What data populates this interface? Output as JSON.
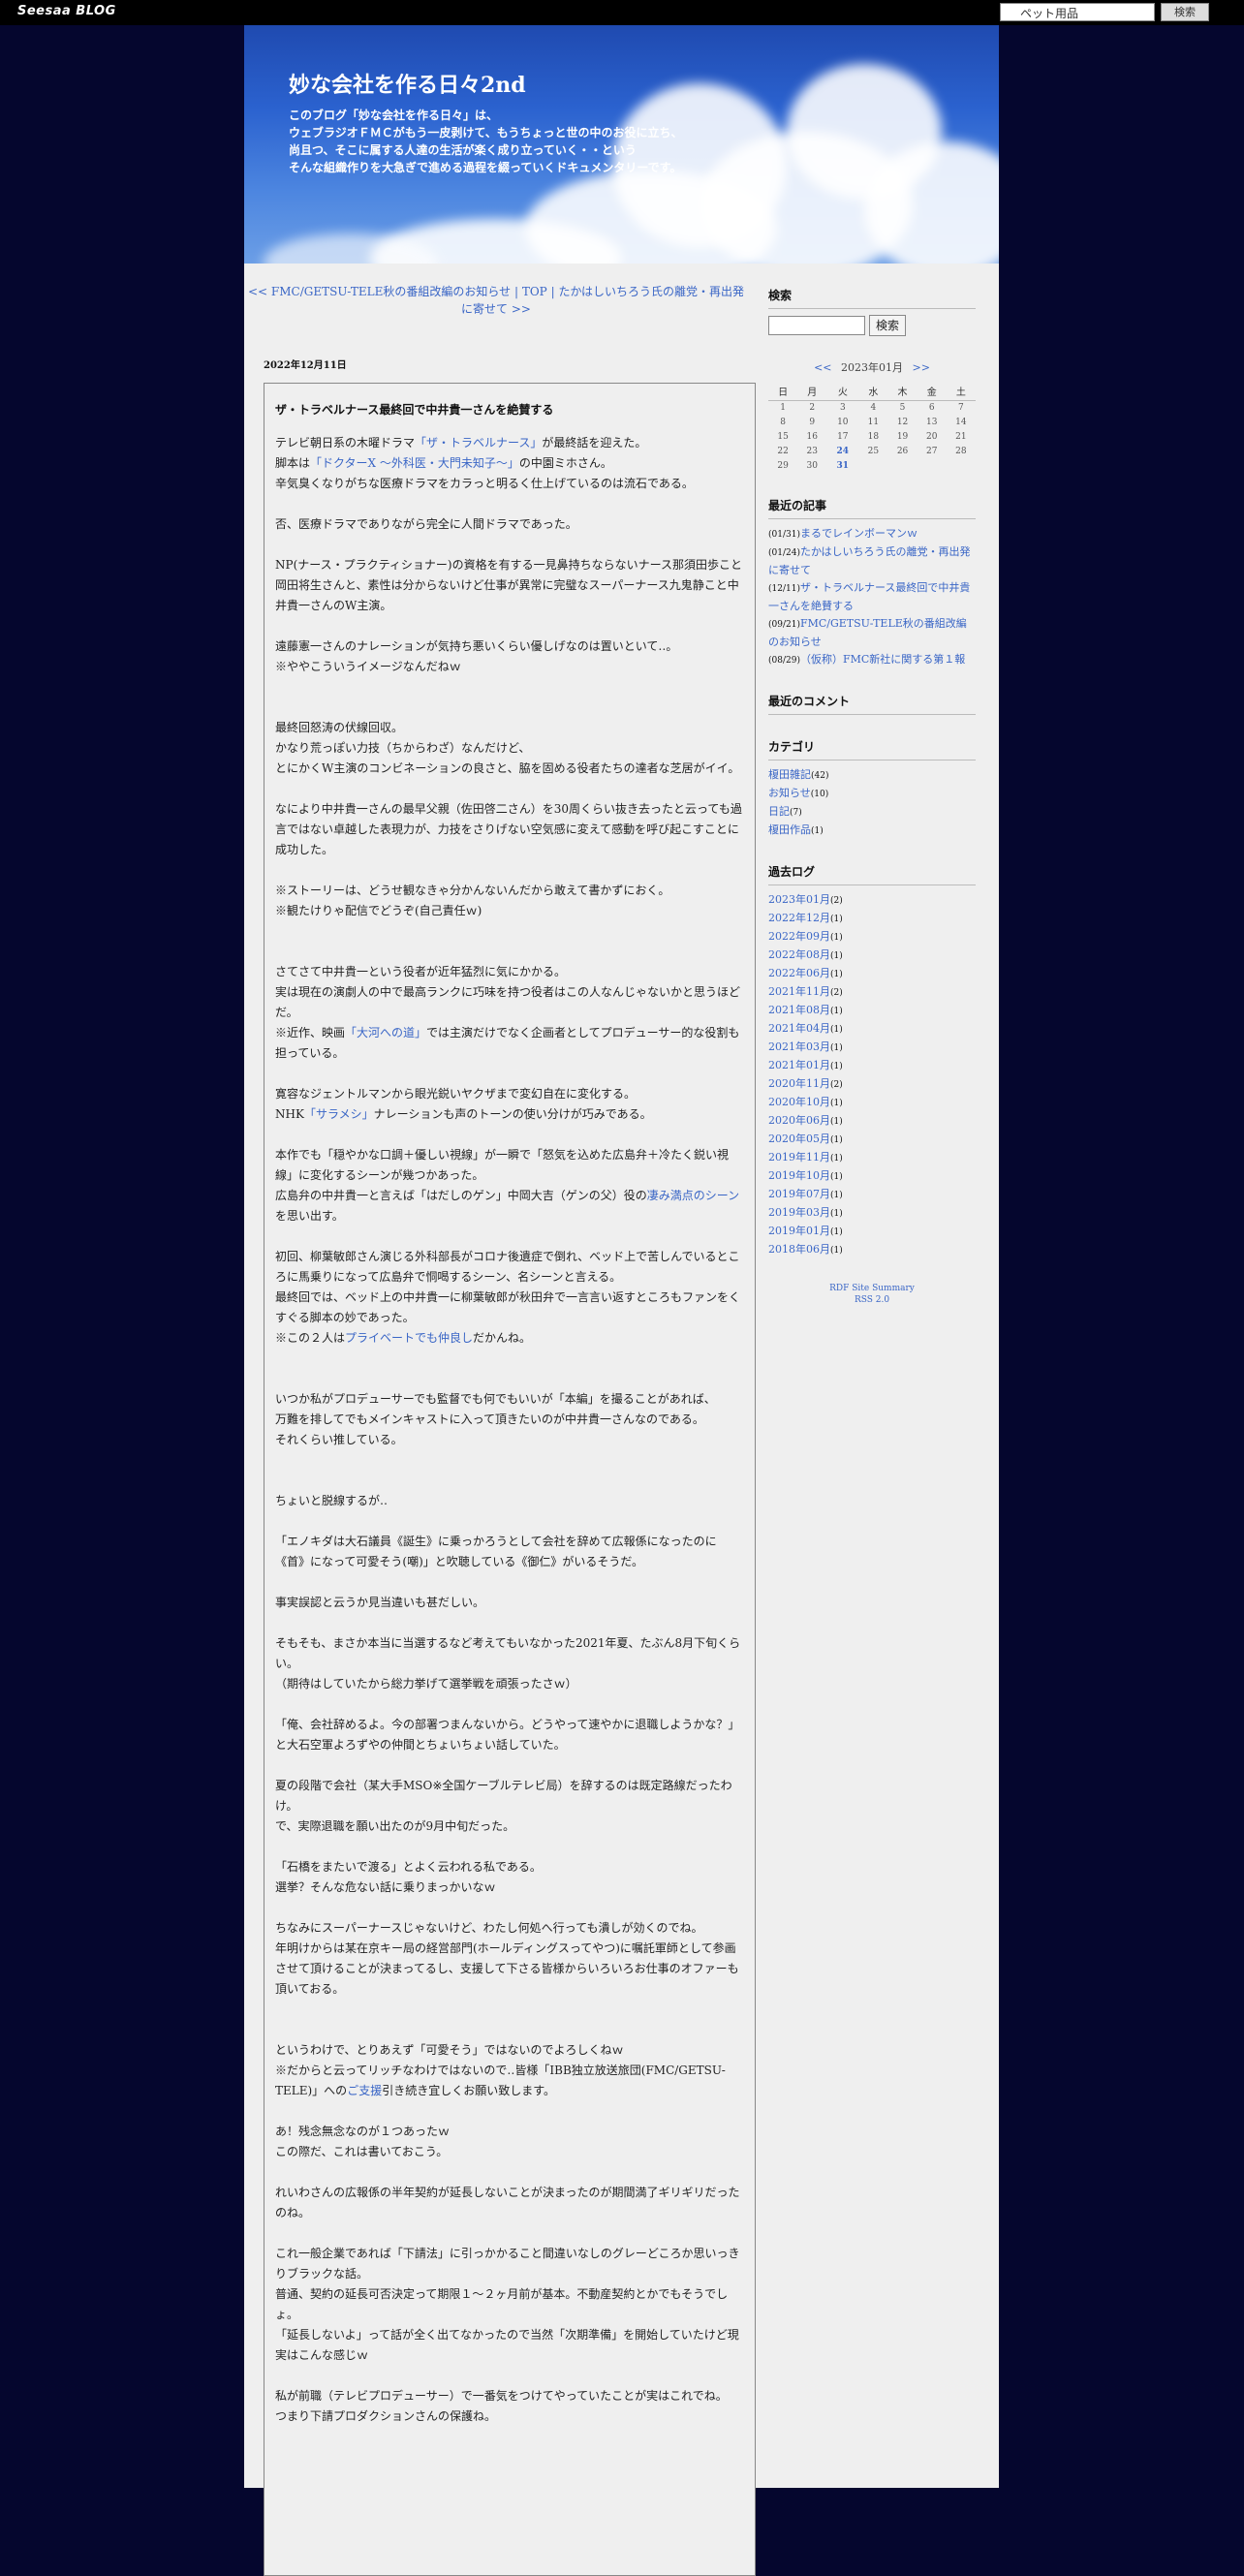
{
  "topbar": {
    "logo": "Seesaa BLOG",
    "search_value": "ペット用品",
    "search_button": "検索"
  },
  "header": {
    "title": "妙な会社を作る日々2nd",
    "desc": [
      "このブログ「妙な会社を作る日々」は、",
      "ウェブラジオＦＭＣがもう一皮剥けて、もうちょっと世の中のお役に立ち、",
      "尚且つ、そこに属する人達の生活が楽く成り立っていく・・という",
      "そんな組織作りを大急ぎで進める過程を綴っていくドキュメンタリーです。"
    ]
  },
  "entry_nav": {
    "prev": "<< FMC/GETSU-TELE秋の番組改編のお知らせ",
    "top": "TOP",
    "next": "たかはしいちろう氏の離党・再出発に寄せて >>",
    "sep": "|"
  },
  "entry": {
    "date": "2022年12月11日",
    "title": "ザ・トラベルナース最終回で中井貴一さんを絶賛する",
    "paragraphs": [
      [
        [
          {
            "t": "テレビ朝日系の木曜ドラマ"
          },
          {
            "t": "「ザ・トラベルナース」",
            "l": 1
          },
          {
            "t": "が最終話を迎えた。"
          }
        ],
        [
          {
            "t": "脚本は"
          },
          {
            "t": "「ドクターX ～外科医・大門未知子～」",
            "l": 1
          },
          {
            "t": "の中園ミホさん。"
          }
        ],
        [
          {
            "t": "辛気臭くなりがちな医療ドラマをカラっと明るく仕上げているのは流石である。"
          }
        ]
      ],
      [
        [
          {
            "t": "否、医療ドラマでありながら完全に人間ドラマであった。"
          }
        ]
      ],
      [
        [
          {
            "t": "NP(ナース・プラクティショナー)の資格を有する一見鼻持ちならないナース那須田歩こと岡田将生さんと、素性は分からないけど仕事が異常に完璧なスーパーナース九鬼静こと中井貴一さんのW主演。"
          }
        ]
      ],
      [
        [
          {
            "t": "遠藤憲一さんのナレーションが気持ち悪いくらい優しげなのは置いといて‥。"
          }
        ],
        [
          {
            "t": "※ややこういうイメージなんだねｗ"
          }
        ]
      ],
      [
        [
          {
            "t": "最終回怒涛の伏線回収。"
          }
        ],
        [
          {
            "t": "かなり荒っぽい力技（ちからわざ）なんだけど、"
          }
        ],
        [
          {
            "t": "とにかくW主演のコンビネーションの良さと、脇を固める役者たちの達者な芝居がイイ。"
          }
        ]
      ],
      [
        [
          {
            "t": "なにより中井貴一さんの最早父親（佐田啓二さん）を30周くらい抜き去ったと云っても過言ではない卓越した表現力が、力技をさりげない空気感に変えて感動を呼び起こすことに成功した。"
          }
        ]
      ],
      [
        [
          {
            "t": "※ストーリーは、どうせ観なきゃ分かんないんだから敢えて書かずにおく。"
          }
        ],
        [
          {
            "t": "※観たけりゃ配信でどうぞ(自己責任ｗ)"
          }
        ]
      ],
      [
        [
          {
            "t": "さてさて中井貴一という役者が近年猛烈に気にかかる。"
          }
        ],
        [
          {
            "t": "実は現在の演劇人の中で最高ランクに巧味を持つ役者はこの人なんじゃないかと思うほどだ。"
          }
        ],
        [
          {
            "t": "※近作、映画"
          },
          {
            "t": "「大河への道」",
            "l": 1
          },
          {
            "t": "では主演だけでなく企画者としてプロデューサー的な役割も担っている。"
          }
        ]
      ],
      [
        [
          {
            "t": "寛容なジェントルマンから眼光鋭いヤクザまで変幻自在に変化する。"
          }
        ],
        [
          {
            "t": "NHK"
          },
          {
            "t": "「サラメシ」",
            "l": 1
          },
          {
            "t": "ナレーションも声のトーンの使い分けが巧みである。"
          }
        ]
      ],
      [
        [
          {
            "t": "本作でも「穏やかな口調＋優しい視線」が一瞬で「怒気を込めた広島弁＋冷たく鋭い視線」に変化するシーンが幾つかあった。"
          }
        ],
        [
          {
            "t": "広島弁の中井貴一と言えば「はだしのゲン」中岡大吉（ゲンの父）役の"
          },
          {
            "t": "凄み満点のシーン",
            "l": 1
          },
          {
            "t": "を思い出す。"
          }
        ]
      ],
      [
        [
          {
            "t": "初回、柳葉敏郎さん演じる外科部長がコロナ後遺症で倒れ、ベッド上で苦しんでいるところに馬乗りになって広島弁で恫喝するシーン、名シーンと言える。"
          }
        ],
        [
          {
            "t": "最終回では、ベッド上の中井貴一に柳葉敏郎が秋田弁で一言言い返すところもファンをくすぐる脚本の妙であった。"
          }
        ],
        [
          {
            "t": "※この２人は"
          },
          {
            "t": "プライベートでも仲良し",
            "l": 1
          },
          {
            "t": "だかんね。"
          }
        ]
      ],
      [
        [
          {
            "t": "いつか私がプロデューサーでも監督でも何でもいいが「本編」を撮ることがあれば、"
          }
        ],
        [
          {
            "t": "万難を排してでもメインキャストに入って頂きたいのが中井貴一さんなのである。"
          }
        ],
        [
          {
            "t": "それくらい推している。"
          }
        ]
      ],
      [
        [
          {
            "t": "ちょいと脱線するが‥"
          }
        ]
      ],
      [
        [
          {
            "t": "「エノキダは大石議員《誕生》に乗っかろうとして会社を辞めて広報係になったのに《首》になって可愛そう(嘲)」と吹聴している《御仁》がいるそうだ。"
          }
        ]
      ],
      [
        [
          {
            "t": "事実誤認と云うか見当違いも甚だしい。"
          }
        ]
      ],
      [
        [
          {
            "t": "そもそも、まさか本当に当選するなど考えてもいなかった2021年夏、たぶん8月下旬くらい。"
          }
        ],
        [
          {
            "t": "（期待はしていたから総力挙げて選挙戦を頑張ったさｗ）"
          }
        ]
      ],
      [
        [
          {
            "t": "「俺、会社辞めるよ。今の部署つまんないから。どうやって速やかに退職しようかな？」と大石空軍よろずやの仲間とちょいちょい話していた。"
          }
        ]
      ],
      [
        [
          {
            "t": "夏の段階で会社（某大手MSO※全国ケーブルテレビ局）を辞するのは既定路線だったわけ。"
          }
        ],
        [
          {
            "t": "で、実際退職を願い出たのが9月中旬だった。"
          }
        ]
      ],
      [
        [
          {
            "t": "「石橋をまたいで渡る」とよく云われる私である。"
          }
        ],
        [
          {
            "t": "選挙？そんな危ない話に乗りまっかいなｗ"
          }
        ]
      ],
      [
        [
          {
            "t": "ちなみにスーパーナースじゃないけど、わたし何処へ行っても潰しが効くのでね。"
          }
        ],
        [
          {
            "t": "年明けからは某在京キー局の経営部門(ホールディングスってやつ)に嘱託軍師として参画させて頂けることが決まってるし、支援して下さる皆様からいろいろお仕事のオファーも頂いておる。"
          }
        ]
      ],
      [
        [
          {
            "t": "というわけで、とりあえず「可愛そう」ではないのでよろしくねｗ"
          }
        ],
        [
          {
            "t": "※だからと云ってリッチなわけではないので‥皆様「IBB独立放送旅団(FMC/GETSU-TELE)」への"
          },
          {
            "t": "ご支援",
            "l": 1
          },
          {
            "t": "引き続き宜しくお願い致します。"
          }
        ]
      ],
      [
        [
          {
            "t": "あ！残念無念なのが１つあったｗ"
          }
        ],
        [
          {
            "t": "この際だ、これは書いておこう。"
          }
        ]
      ],
      [
        [
          {
            "t": "れいわさんの広報係の半年契約が延長しないことが決まったのが期間満了ギリギリだったのね。"
          }
        ]
      ],
      [
        [
          {
            "t": "これ一般企業であれば「下請法」に引っかかること間違いなしのグレーどころか思いっきりブラックな話。"
          }
        ],
        [
          {
            "t": "普通、契約の延長可否決定って期限１～２ヶ月前が基本。不動産契約とかでもそうでしょ。"
          }
        ],
        [
          {
            "t": "「延長しないよ」って話が全く出てなかったので当然「次期準備」を開始していたけど現実はこんな感じｗ"
          }
        ]
      ],
      [
        [
          {
            "t": "私が前職（テレビプロデューサー）で一番気をつけてやっていたことが実はこれでね。"
          }
        ],
        [
          {
            "t": "つまり下請プロダクションさんの保護ね。"
          }
        ]
      ]
    ]
  },
  "sidebar": {
    "search": {
      "heading": "検索",
      "button": "検索"
    },
    "calendar": {
      "prev": "<<",
      "month": "2023年01月",
      "next": ">>",
      "weekdays": [
        "日",
        "月",
        "火",
        "水",
        "木",
        "金",
        "土"
      ],
      "weeks": [
        [
          "1",
          "2",
          "3",
          "4",
          "5",
          "6",
          "7"
        ],
        [
          "8",
          "9",
          "10",
          "11",
          "12",
          "13",
          "14"
        ],
        [
          "15",
          "16",
          "17",
          "18",
          "19",
          "20",
          "21"
        ],
        [
          "22",
          "23",
          "24",
          "25",
          "26",
          "27",
          "28"
        ],
        [
          "29",
          "30",
          "31",
          "",
          "",
          "",
          ""
        ]
      ],
      "linked_days": [
        "24",
        "31"
      ]
    },
    "recent_posts": {
      "heading": "最近の記事",
      "items": [
        {
          "date": "(01/31)",
          "title": "まるでレインボーマンｗ"
        },
        {
          "date": "(01/24)",
          "title": "たかはしいちろう氏の離党・再出発に寄せて"
        },
        {
          "date": "(12/11)",
          "title": "ザ・トラベルナース最終回で中井貴一さんを絶賛する"
        },
        {
          "date": "(09/21)",
          "title": "FMC/GETSU-TELE秋の番組改編のお知らせ"
        },
        {
          "date": "(08/29)",
          "title": "（仮称）FMC新社に関する第１報"
        }
      ]
    },
    "recent_comments": {
      "heading": "最近のコメント"
    },
    "categories": {
      "heading": "カテゴリ",
      "items": [
        {
          "name": "榎田雑記",
          "count": "(42)"
        },
        {
          "name": "お知らせ",
          "count": "(10)"
        },
        {
          "name": "日記",
          "count": "(7)"
        },
        {
          "name": "榎田作品",
          "count": "(1)"
        }
      ]
    },
    "archives": {
      "heading": "過去ログ",
      "items": [
        {
          "month": "2023年01月",
          "count": "(2)"
        },
        {
          "month": "2022年12月",
          "count": "(1)"
        },
        {
          "month": "2022年09月",
          "count": "(1)"
        },
        {
          "month": "2022年08月",
          "count": "(1)"
        },
        {
          "month": "2022年06月",
          "count": "(1)"
        },
        {
          "month": "2021年11月",
          "count": "(2)"
        },
        {
          "month": "2021年08月",
          "count": "(1)"
        },
        {
          "month": "2021年04月",
          "count": "(1)"
        },
        {
          "month": "2021年03月",
          "count": "(1)"
        },
        {
          "month": "2021年01月",
          "count": "(1)"
        },
        {
          "month": "2020年11月",
          "count": "(2)"
        },
        {
          "month": "2020年10月",
          "count": "(1)"
        },
        {
          "month": "2020年06月",
          "count": "(1)"
        },
        {
          "month": "2020年05月",
          "count": "(1)"
        },
        {
          "month": "2019年11月",
          "count": "(1)"
        },
        {
          "month": "2019年10月",
          "count": "(1)"
        },
        {
          "month": "2019年07月",
          "count": "(1)"
        },
        {
          "month": "2019年03月",
          "count": "(1)"
        },
        {
          "month": "2019年01月",
          "count": "(1)"
        },
        {
          "month": "2018年06月",
          "count": "(1)"
        }
      ]
    },
    "rss": [
      "RDF Site Summary",
      "RSS 2.0"
    ]
  }
}
